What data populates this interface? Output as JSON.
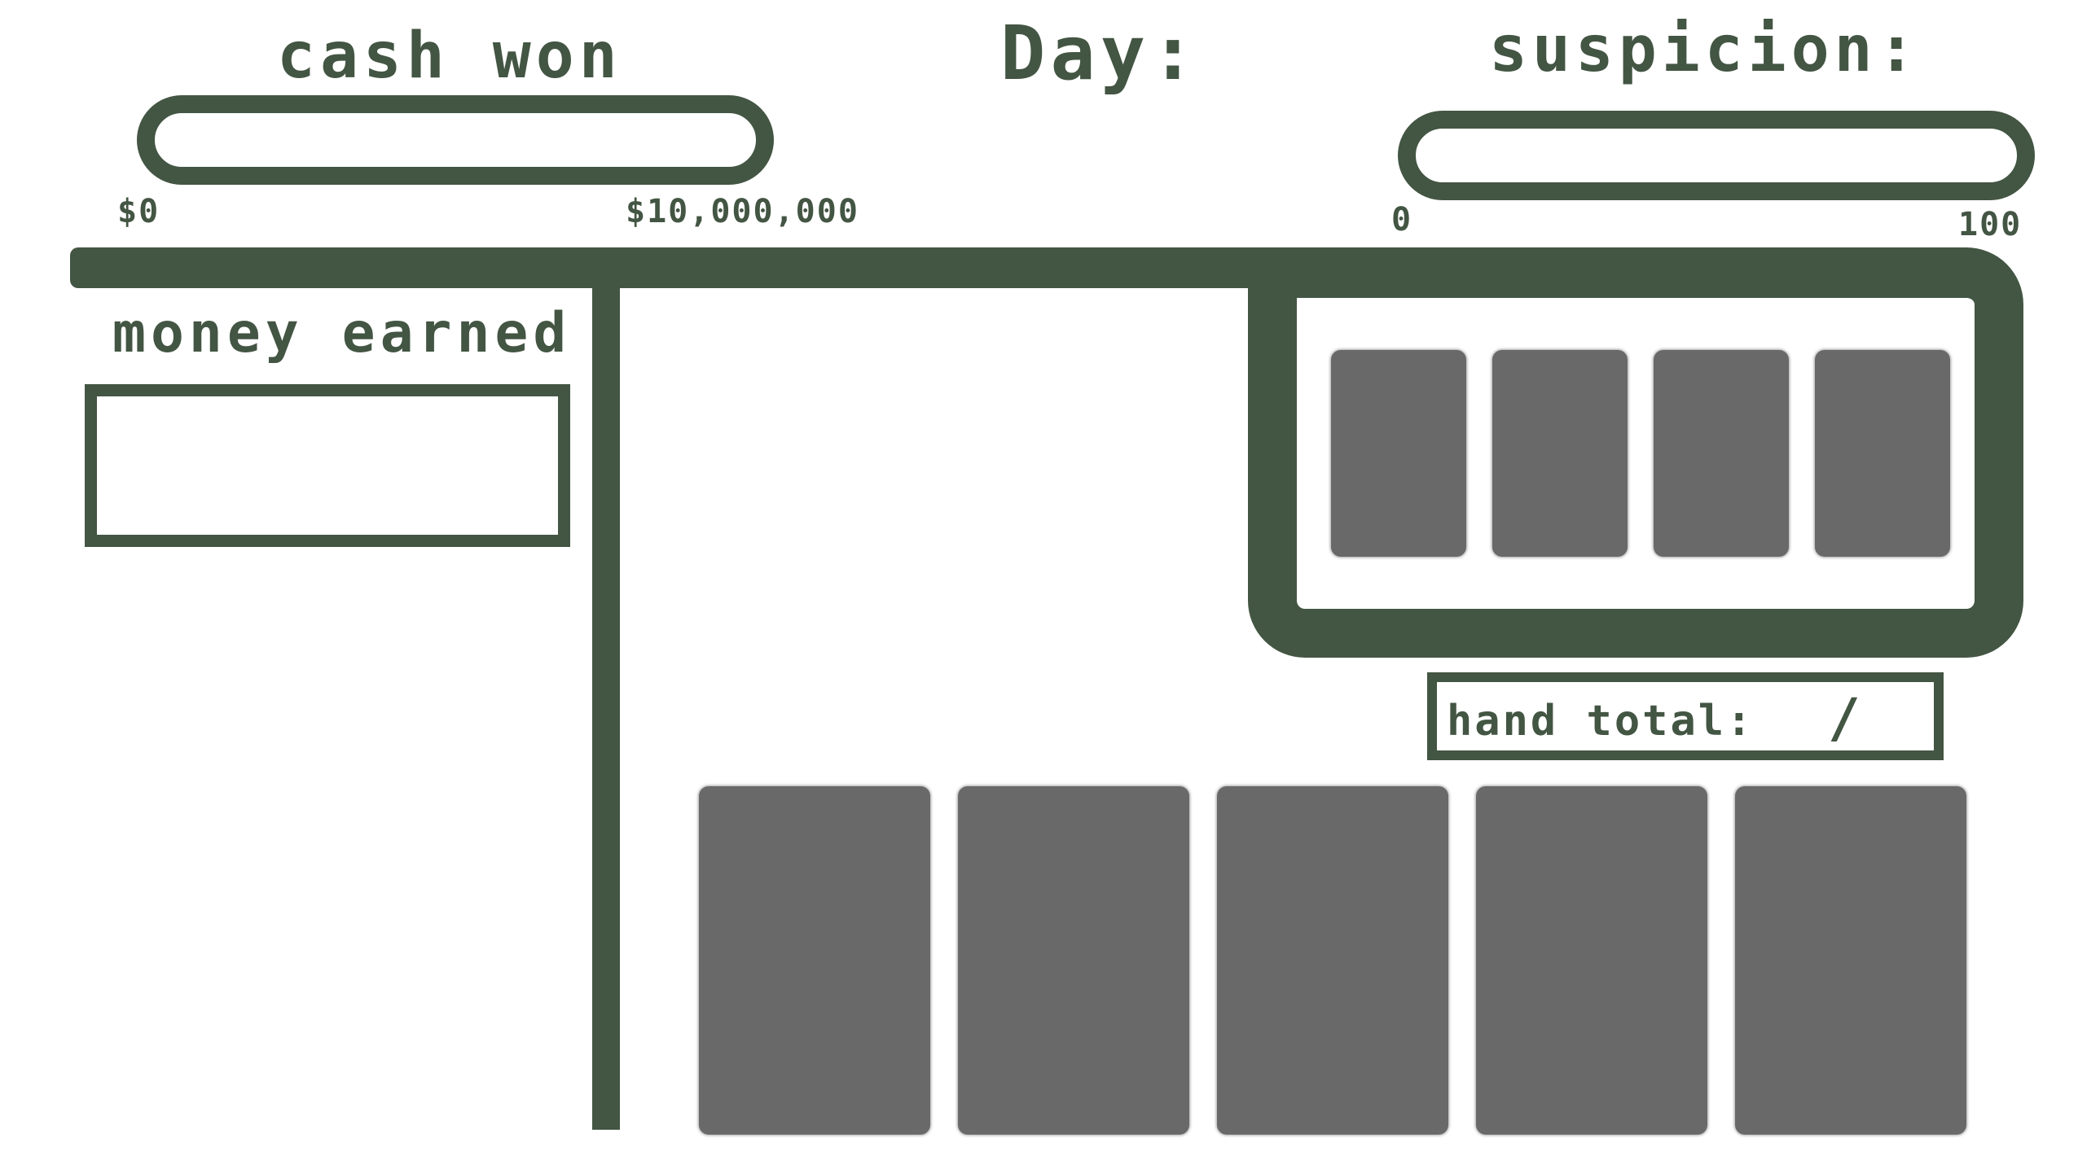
{
  "hud": {
    "cash_won": {
      "title": "cash won",
      "min_label": "$0",
      "max_label": "$10,000,000"
    },
    "day": {
      "title": "Day:"
    },
    "suspicion": {
      "title": "suspicion:",
      "min_label": "0",
      "max_label": "100"
    }
  },
  "sidebar": {
    "money_earned_title": "money earned"
  },
  "table": {
    "hand_total_label": "hand total:",
    "hand_total_separator": "/",
    "dealer_card_count": 4,
    "player_card_count": 5
  },
  "colors": {
    "primary": "#435543",
    "card": "#696969",
    "background": "#ffffff"
  }
}
